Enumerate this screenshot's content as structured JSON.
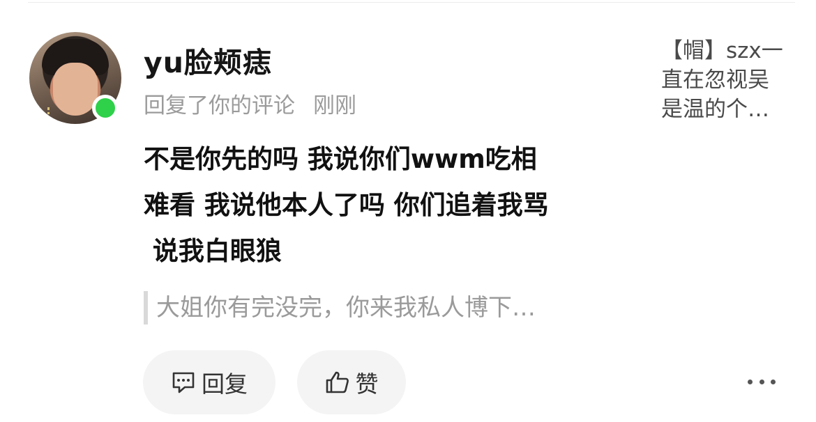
{
  "notification": {
    "username": "yu脸颊痣",
    "action": "回复了你的评论",
    "time": "刚刚",
    "comment_lines": [
      "不是你先的吗 我说你们wwm吃相",
      "难看 我说他本人了吗 你们追着我骂",
      " 说我白眼狼"
    ],
    "quoted_text": "大姐你有完没完，你来我私人博下…",
    "reference_preview_lines": [
      "【帽】szx一",
      "直在忽视吴",
      "是温的个…"
    ],
    "online": true
  },
  "actions": {
    "reply_label": "回复",
    "like_label": "赞",
    "more_icon": "more-horizontal-icon"
  },
  "colors": {
    "online_dot": "#2fd04a",
    "meta_text": "#9b9b9b",
    "button_bg": "#f4f4f4"
  }
}
